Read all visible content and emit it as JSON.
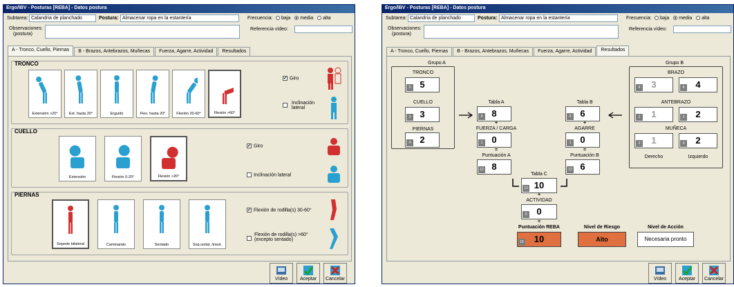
{
  "left_window": {
    "title": "Ergo/IBV - Posturas [REBA] - Datos postura",
    "subtarea_label": "Subtarea:",
    "subtarea_value": "Calandria de planchado",
    "postura_label": "Postura:",
    "postura_value": "Almacenar ropa en la estantería",
    "frecuencia_label": "Frecuencia:",
    "freq_options": [
      "baja",
      "media",
      "alta"
    ],
    "freq_selected": "media",
    "observaciones_label": "Observaciones:",
    "observaciones_sub": "(postura)",
    "referencia_label": "Referencia vídeo:",
    "tabs": [
      "A - Tronco, Cuello, Piernas",
      "B - Brazos, Antebrazos, Muñecas",
      "Fuerza, Agarre, Actividad",
      "Resultados"
    ],
    "active_tab": 0,
    "tronco": {
      "title": "TRONCO",
      "cards": [
        "Extensión >20°",
        "Ext. hasta 20°",
        "Erguido",
        "Flex. hasta 20°",
        "Flexión 20-60°",
        "Flexión >60°"
      ],
      "selected": 5,
      "giro_label": "Giro",
      "giro_checked": true,
      "inclinacion_label": "Inclinación lateral",
      "inclinacion_checked": false
    },
    "cuello": {
      "title": "CUELLO",
      "cards": [
        "Extensión",
        "Flexión 0-20°",
        "Flexión >20°"
      ],
      "selected": 2,
      "giro_label": "Giro",
      "giro_checked": true,
      "inclinacion_label": "Inclinación lateral",
      "inclinacion_checked": false
    },
    "piernas": {
      "title": "PIERNAS",
      "cards": [
        "Soporte bilateral",
        "Caminando",
        "Sentado",
        "Sop.unilat. /inest."
      ],
      "selected": 0,
      "flex1_label": "Flexión de rodilla(s) 30-60°",
      "flex1_checked": true,
      "flex2_label": "Flexión de rodilla(s) >60° (excepto sentado)",
      "flex2_checked": false
    },
    "buttons": [
      "Vídeo",
      "Aceptar",
      "Cancelar"
    ]
  },
  "right_window": {
    "title": "Ergo/IBV - Posturas [REBA] - Datos postura",
    "subtarea_label": "Subtarea:",
    "subtarea_value": "Calandria de planchado",
    "postura_label": "Postura:",
    "postura_value": "Almacenar ropa en la estantería",
    "frecuencia_label": "Frecuencia:",
    "freq_options": [
      "baja",
      "media",
      "alta"
    ],
    "freq_selected": "media",
    "observaciones_label": "Observaciones:",
    "observaciones_sub": "(postura)",
    "referencia_label": "Referencia vídeo:",
    "tabs": [
      "A - Tronco, Cuello, Piernas",
      "B - Brazos, Antebrazos, Muñecas",
      "Fuerza, Agarre, Actividad",
      "Resultados"
    ],
    "active_tab": 3,
    "grupo_a": {
      "title": "Grupo A",
      "tronco_label": "TRONCO",
      "tronco_value": "5",
      "tronco_idx": "5",
      "cuello_label": "CUELLO",
      "cuello_value": "3",
      "cuello_idx": "3",
      "piernas_label": "PIERNAS",
      "piernas_value": "2",
      "piernas_idx": "4"
    },
    "tabla_a": {
      "title": "Tabla A",
      "value": "8",
      "idx": "9",
      "plus": "+",
      "fuerza_label": "FUERZA / CARGA",
      "fuerza_value": "0",
      "fuerza_idx": "1",
      "eq": "=",
      "puntuacion_label": "Puntuación A",
      "puntuacion_value": "8",
      "puntuacion_idx": "12"
    },
    "tabla_b": {
      "title": "Tabla B",
      "value": "6",
      "idx": "9",
      "plus": "+",
      "agarre_label": "AGARRE",
      "agarre_value": "0",
      "agarre_idx": "1",
      "eq": "=",
      "puntuacion_label": "Puntuación B",
      "puntuacion_value": "6",
      "puntuacion_idx": "12"
    },
    "tabla_c": {
      "title": "Tabla C",
      "value": "10",
      "idx": "12",
      "plus": "+",
      "actividad_label": "ACTIVIDAD",
      "actividad_value": "0",
      "actividad_idx": "3",
      "eq": "="
    },
    "grupo_b": {
      "title": "Grupo B",
      "brazo_label": "BRAZO",
      "brazo_der": "3",
      "brazo_der_idx": "4",
      "brazo_izq": "4",
      "brazo_izq_idx": "6",
      "antebrazo_label": "ANTEBRAZO",
      "antebrazo_der": "1",
      "antebrazo_der_idx": "2",
      "antebrazo_izq": "2",
      "antebrazo_izq_idx": "2",
      "muneca_label": "MUÑECA",
      "muneca_der": "1",
      "muneca_der_idx": "3",
      "muneca_izq": "2",
      "muneca_izq_idx": "3",
      "derecho_label": "Derecho",
      "izquierdo_label": "Izquierdo"
    },
    "resultado": {
      "reba_label": "Puntuación REBA",
      "reba_value": "10",
      "reba_idx": "15",
      "riesgo_label": "Nivel de Riesgo",
      "riesgo_value": "Alto",
      "accion_label": "Nivel de Acción",
      "accion_value": "Necesaria pronto",
      "accent": "#e07040"
    },
    "buttons": [
      "Vídeo",
      "Aceptar",
      "Cancelar"
    ]
  }
}
